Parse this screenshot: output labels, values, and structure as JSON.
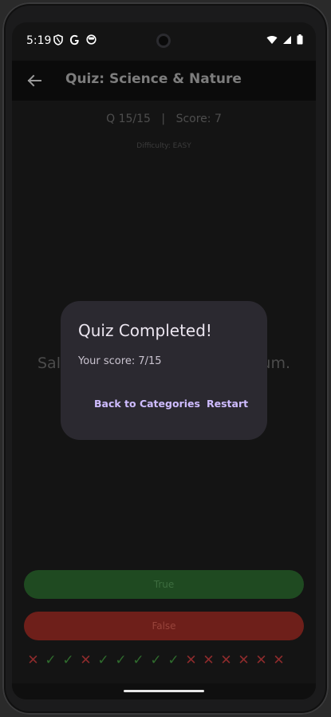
{
  "status": {
    "time": "5:19",
    "left_icons": [
      "shield-icon",
      "google-icon",
      "privacy-icon"
    ],
    "right_icons": [
      "wifi-icon",
      "signal-icon",
      "battery-icon"
    ]
  },
  "appbar": {
    "title": "Quiz: Science & Nature",
    "back_icon": "arrow-left-icon"
  },
  "quiz": {
    "question_number": "Q 15/15",
    "separator": "|",
    "score": "Score: 7",
    "difficulty": "Difficulty: EASY",
    "question_left": "Salt",
    "question_right": "um.",
    "true_label": "True",
    "false_label": "False",
    "results": [
      false,
      true,
      true,
      false,
      true,
      true,
      true,
      true,
      true,
      false,
      false,
      false,
      false,
      false,
      false
    ]
  },
  "dialog": {
    "title": "Quiz Completed!",
    "body": "Your score: 7/15",
    "back_label": "Back to Categories",
    "restart_label": "Restart"
  },
  "colors": {
    "accent": "#cfbcff",
    "true_button": "#1f4a21",
    "false_button": "#6e1f1a",
    "correct_mark": "#2f6b2d",
    "wrong_mark": "#8d2b2c"
  }
}
